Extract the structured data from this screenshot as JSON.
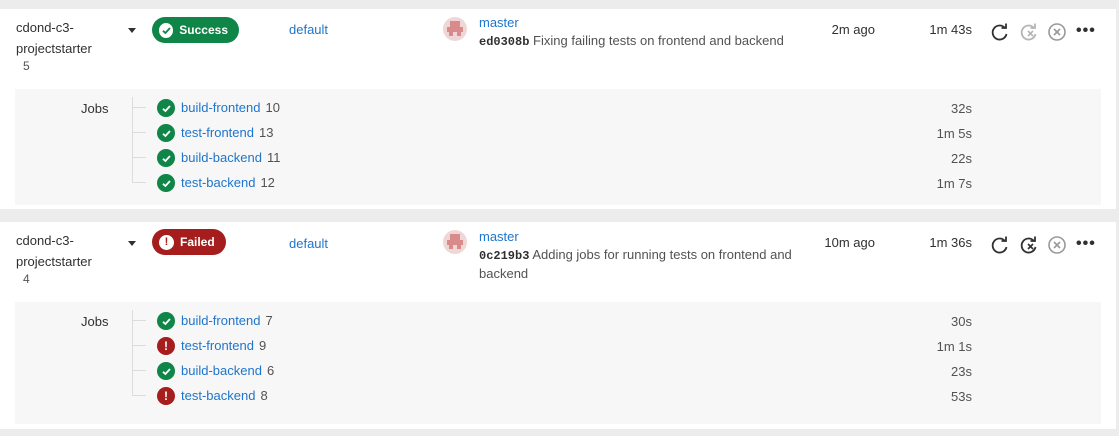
{
  "colors": {
    "success": "#108548",
    "failed": "#a51d1d",
    "link": "#1f75cb"
  },
  "pipelines": [
    {
      "project": "cdond-c3-",
      "project2": "projectstarter",
      "id": "5",
      "status": "Success",
      "branch_label": "default",
      "ref": "master",
      "sha": "ed0308b",
      "message": "Fixing failing tests on frontend and backend",
      "ago": "2m ago",
      "duration": "1m 43s",
      "jobs_label": "Jobs",
      "jobs": [
        {
          "name": "build-frontend",
          "num": "10",
          "status": "success",
          "duration": "32s"
        },
        {
          "name": "test-frontend",
          "num": "13",
          "status": "success",
          "duration": "1m 5s"
        },
        {
          "name": "build-backend",
          "num": "11",
          "status": "success",
          "duration": "22s"
        },
        {
          "name": "test-backend",
          "num": "12",
          "status": "success",
          "duration": "1m 7s"
        }
      ]
    },
    {
      "project": "cdond-c3-",
      "project2": "projectstarter",
      "id": "4",
      "status": "Failed",
      "branch_label": "default",
      "ref": "master",
      "sha": "0c219b3",
      "message": "Adding jobs for running tests on frontend and backend",
      "ago": "10m ago",
      "duration": "1m 36s",
      "jobs_label": "Jobs",
      "jobs": [
        {
          "name": "build-frontend",
          "num": "7",
          "status": "success",
          "duration": "30s"
        },
        {
          "name": "test-frontend",
          "num": "9",
          "status": "failed",
          "duration": "1m 1s"
        },
        {
          "name": "build-backend",
          "num": "6",
          "status": "success",
          "duration": "23s"
        },
        {
          "name": "test-backend",
          "num": "8",
          "status": "failed",
          "duration": "53s"
        }
      ]
    }
  ]
}
